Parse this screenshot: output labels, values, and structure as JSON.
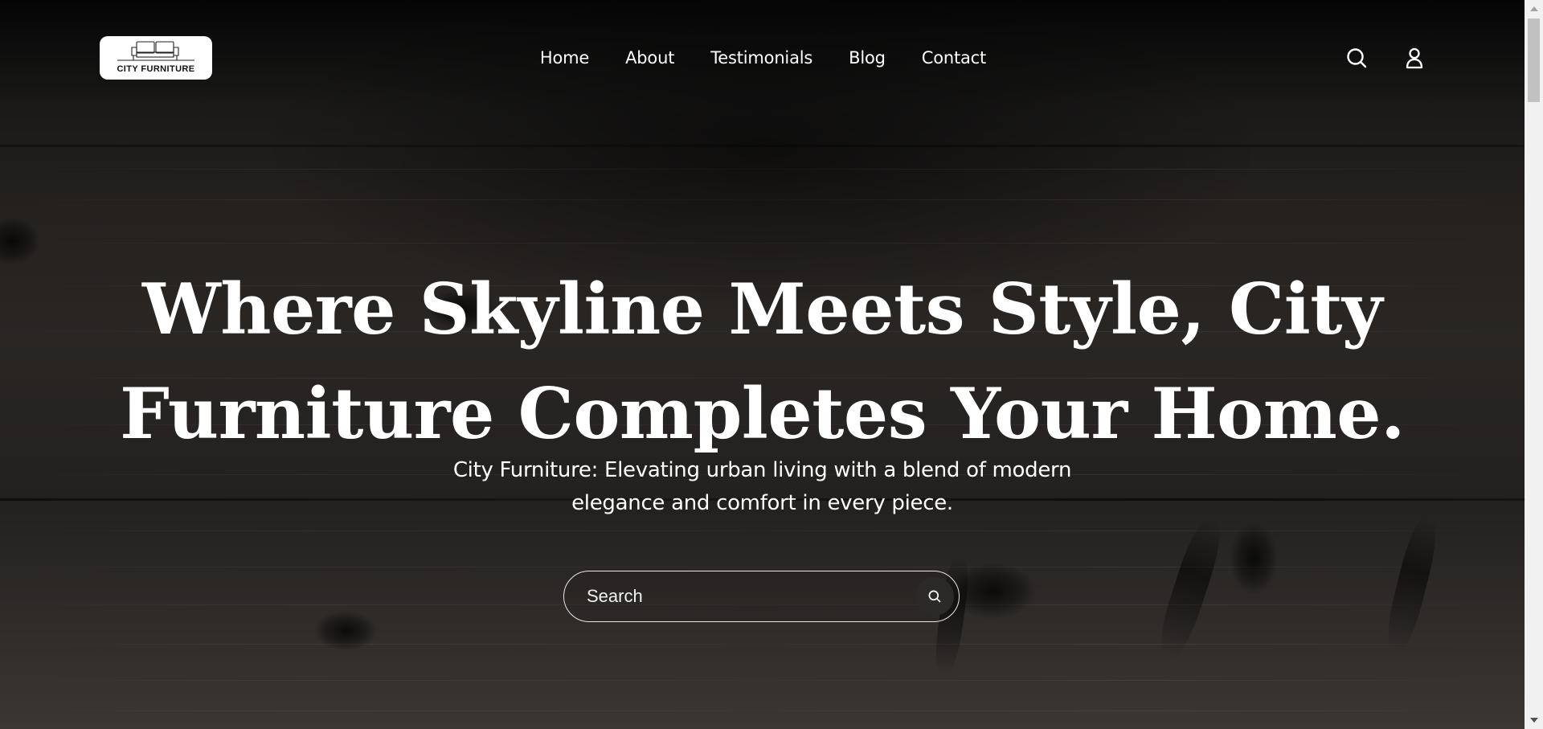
{
  "header": {
    "logo": {
      "text": "CITY FURNITURE",
      "icon": "sofa-icon"
    },
    "nav": [
      {
        "label": "Home"
      },
      {
        "label": "About"
      },
      {
        "label": "Testimonials"
      },
      {
        "label": "Blog"
      },
      {
        "label": "Contact"
      }
    ],
    "icons": [
      "search-icon",
      "user-icon"
    ]
  },
  "hero": {
    "title": "Where Skyline Meets Style, City\nFurniture Completes Your Home.",
    "subtitle": "City Furniture: Elevating urban living with a blend of modern\nelegance and comfort in every piece.",
    "search": {
      "placeholder": "Search",
      "button_icon": "search-icon"
    }
  },
  "colors": {
    "text": "#ffffff",
    "background": "#1f1c1a",
    "logo_bg": "#ffffff"
  }
}
